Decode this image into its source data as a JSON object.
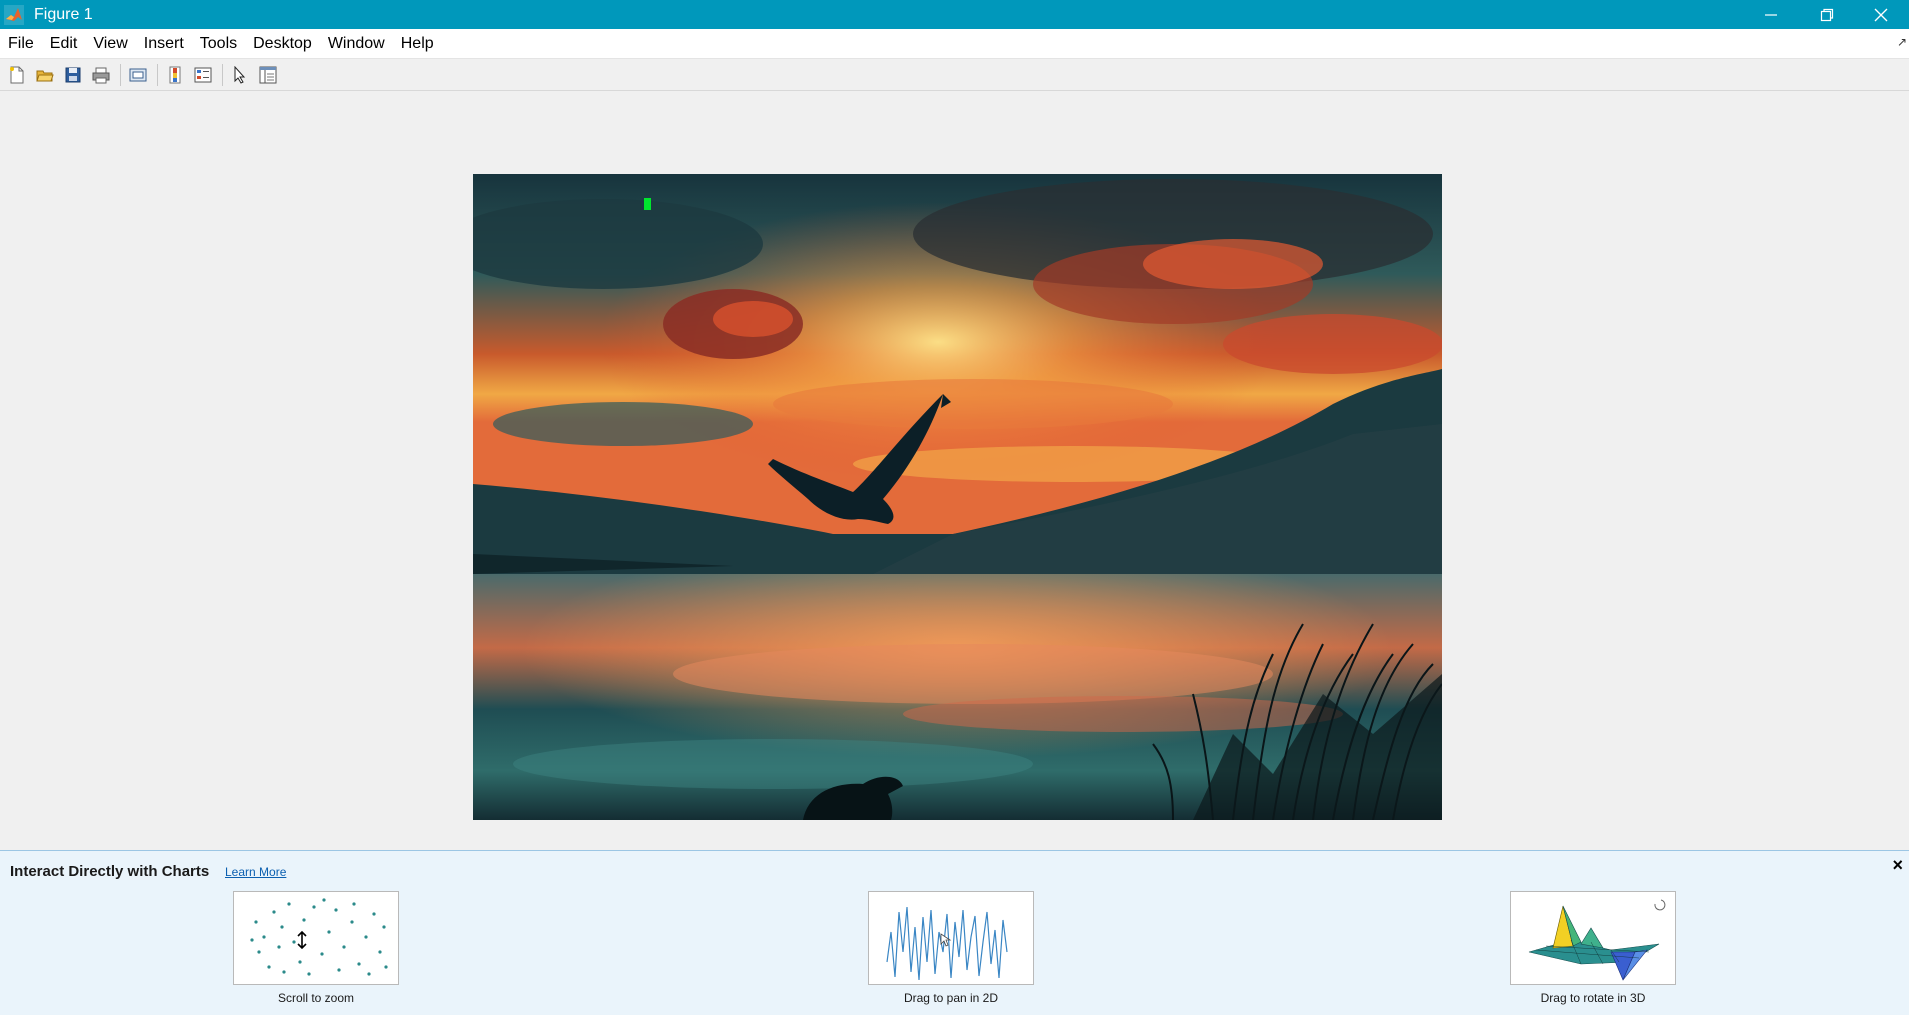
{
  "window": {
    "title": "Figure 1",
    "controls": [
      "minimize-icon",
      "restore-icon",
      "close-icon"
    ]
  },
  "menubar": {
    "items": [
      {
        "label": "File"
      },
      {
        "label": "Edit"
      },
      {
        "label": "View"
      },
      {
        "label": "Insert"
      },
      {
        "label": "Tools"
      },
      {
        "label": "Desktop"
      },
      {
        "label": "Window"
      },
      {
        "label": "Help"
      }
    ]
  },
  "toolbar": {
    "buttons": [
      "new-figure-icon",
      "open-file-icon",
      "save-icon",
      "print-icon",
      "link-plot-icon",
      "colorbar-icon",
      "legend-icon",
      "edit-plot-icon",
      "property-inspector-icon"
    ]
  },
  "figure": {
    "image_subject": "eagle over lake at sunset"
  },
  "tips_panel": {
    "title": "Interact Directly with Charts",
    "learn_more": "Learn More",
    "close": "×",
    "tips": [
      {
        "label": "Scroll to zoom"
      },
      {
        "label": "Drag to pan in 2D"
      },
      {
        "label": "Drag to rotate in 3D"
      }
    ]
  },
  "colors": {
    "titlebar": "#0098bb",
    "tips_background": "#eaf4fb",
    "link": "#0b5fb0"
  }
}
